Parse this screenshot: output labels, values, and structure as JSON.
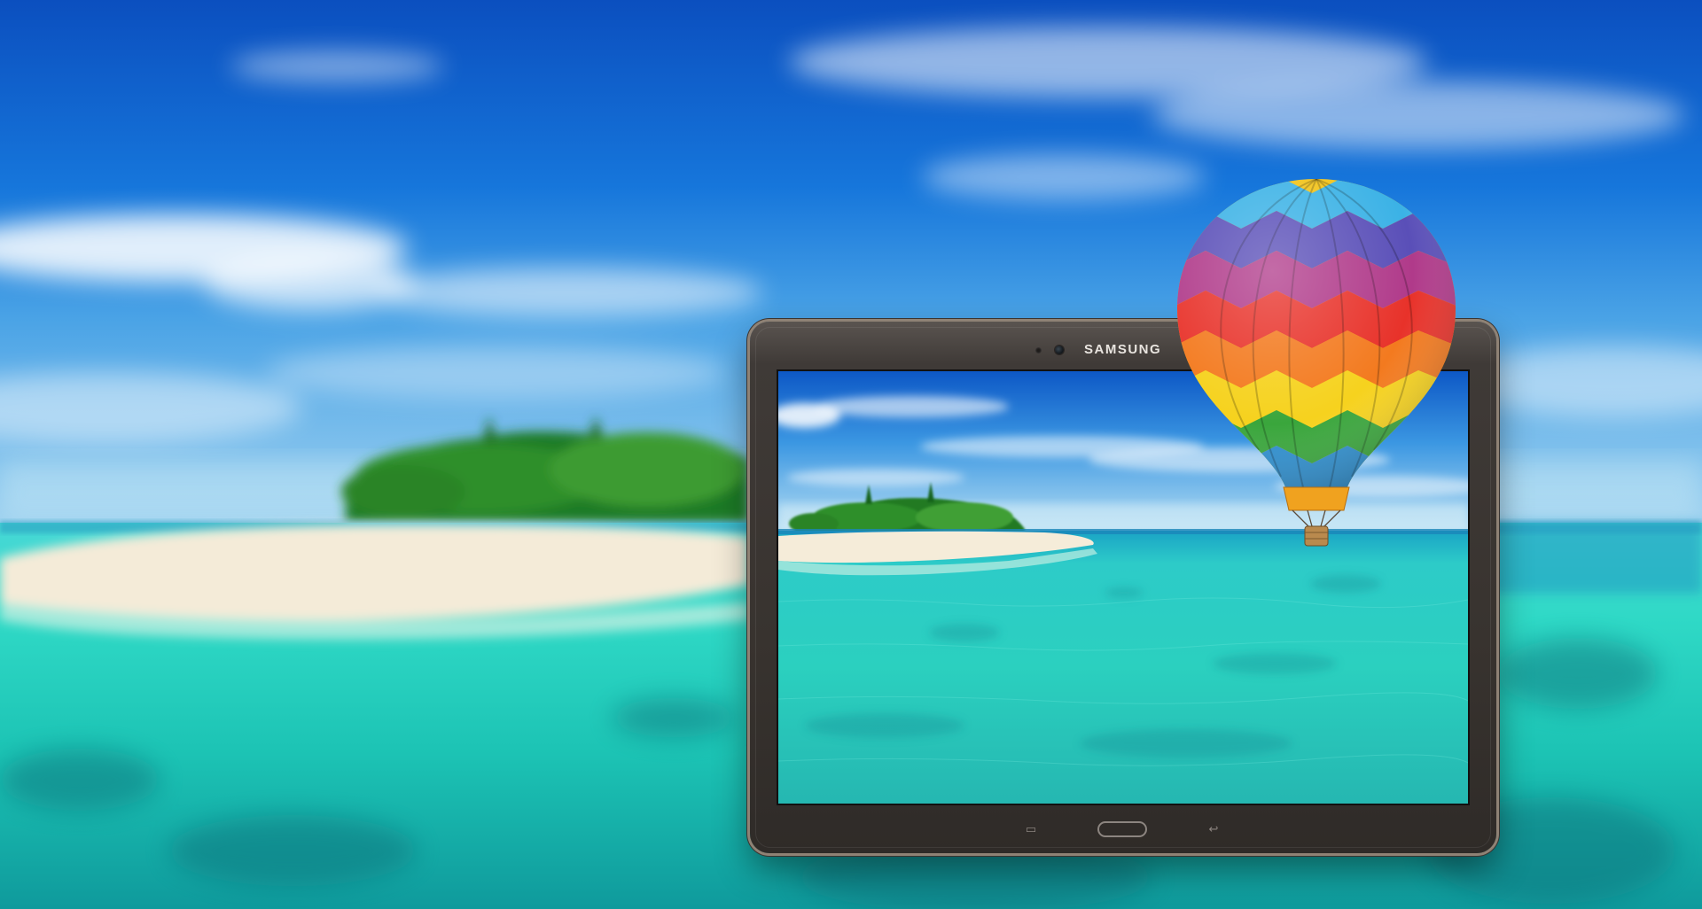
{
  "device": {
    "brand": "SAMSUNG"
  },
  "icons": {
    "recent_apps": "recent-apps-icon",
    "home": "home-button",
    "back": "back-icon"
  },
  "colors": {
    "sky": "#1673d6",
    "ocean": "#2fd3c4",
    "sand": "#f3e9d6",
    "bezel": "#3d3834",
    "trim": "#8f8275"
  }
}
